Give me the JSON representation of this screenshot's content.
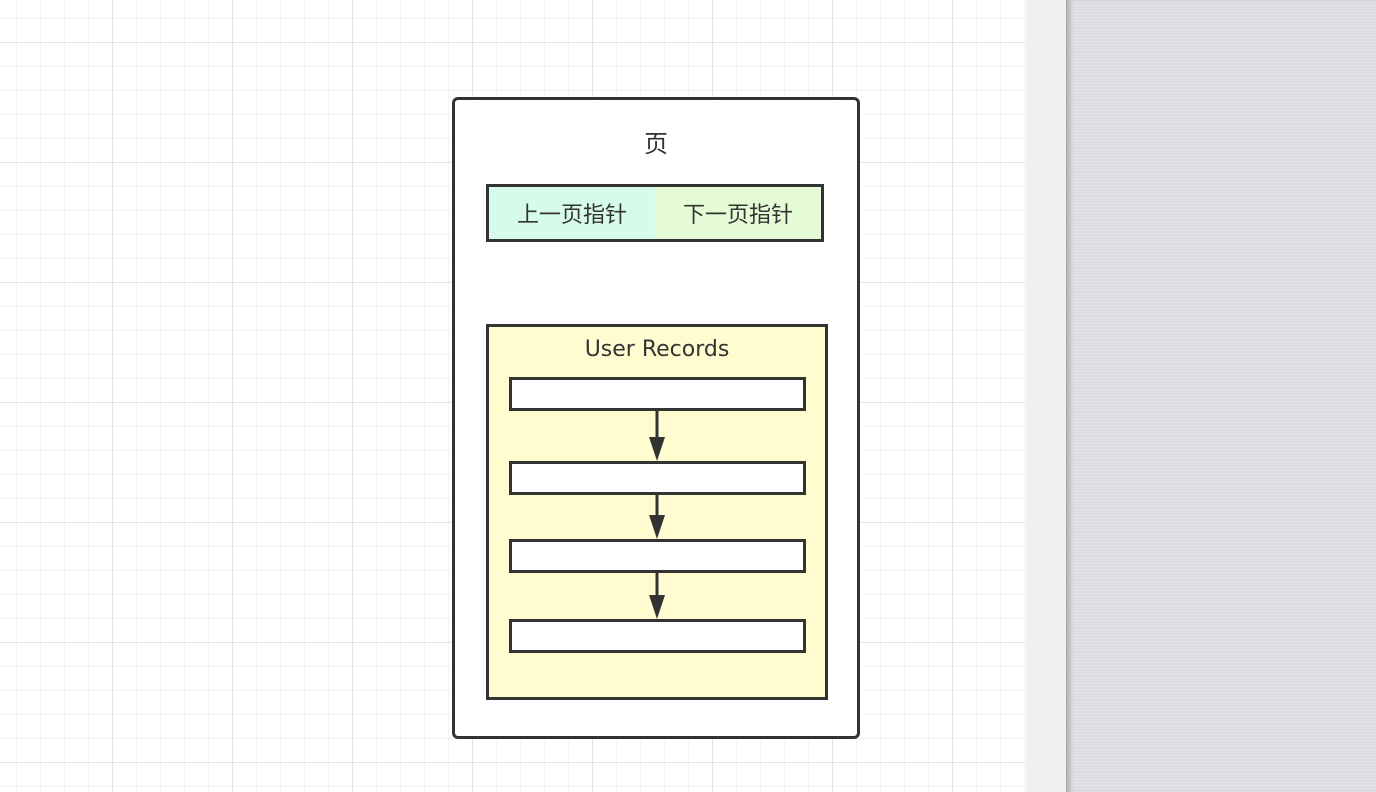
{
  "diagram": {
    "page_title": "页",
    "prev_pointer_label": "上一页指针",
    "next_pointer_label": "下一页指针",
    "records_label": "User Records",
    "record_count": 4,
    "colors": {
      "border": "#333333",
      "prev_fill": "#d6fbe8",
      "next_fill": "#e4fbd6",
      "records_fill": "#fffdd0",
      "record_fill": "#ffffff"
    }
  }
}
